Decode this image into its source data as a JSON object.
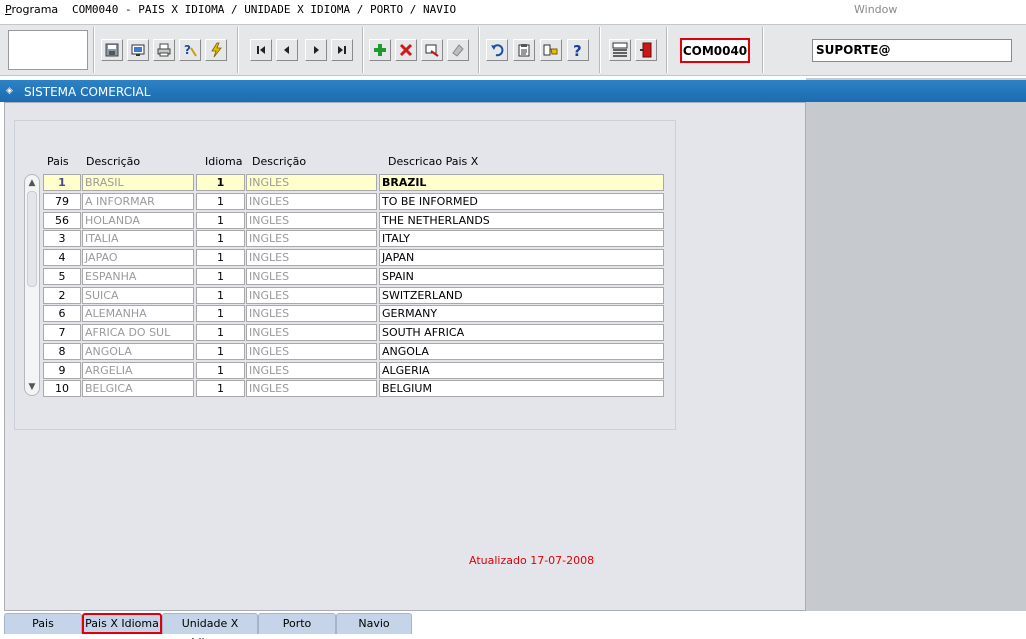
{
  "menubar": {
    "programa": "Programa",
    "title": "COM0040 - PAIS X IDIOMA / UNIDADE X IDIOMA / PORTO / NAVIO",
    "window": "Window"
  },
  "toolbar": {
    "module_code": "COM0040",
    "user": "SUPORTE@",
    "buttons": [
      "save",
      "print-screen",
      "print",
      "help-query",
      "tools",
      "first-record",
      "previous-record",
      "next-record",
      "last-record",
      "insert-record",
      "delete-record",
      "duplicate-record",
      "clear-record",
      "undo",
      "clipboard",
      "options",
      "help",
      "menu",
      "exit"
    ]
  },
  "window": {
    "title": "SISTEMA COMERCIAL"
  },
  "grid": {
    "headers": {
      "pais": "Pais",
      "descricao1": "Descrição",
      "idioma": "Idioma",
      "descricao2": "Descrição",
      "descricao_pais": "Descricao Pais X"
    },
    "rows": [
      {
        "pais": "1",
        "descricao": "BRASIL",
        "idioma": "1",
        "idioma_desc": "INGLES",
        "traducao": "BRAZIL"
      },
      {
        "pais": "79",
        "descricao": "A INFORMAR",
        "idioma": "1",
        "idioma_desc": "INGLES",
        "traducao": "TO BE INFORMED"
      },
      {
        "pais": "56",
        "descricao": "HOLANDA",
        "idioma": "1",
        "idioma_desc": "INGLES",
        "traducao": "THE NETHERLANDS"
      },
      {
        "pais": "3",
        "descricao": "ITALIA",
        "idioma": "1",
        "idioma_desc": "INGLES",
        "traducao": "ITALY"
      },
      {
        "pais": "4",
        "descricao": "JAPAO",
        "idioma": "1",
        "idioma_desc": "INGLES",
        "traducao": "JAPAN"
      },
      {
        "pais": "5",
        "descricao": "ESPANHA",
        "idioma": "1",
        "idioma_desc": "INGLES",
        "traducao": "SPAIN"
      },
      {
        "pais": "2",
        "descricao": "SUICA",
        "idioma": "1",
        "idioma_desc": "INGLES",
        "traducao": "SWITZERLAND"
      },
      {
        "pais": "6",
        "descricao": "ALEMANHA",
        "idioma": "1",
        "idioma_desc": "INGLES",
        "traducao": "GERMANY"
      },
      {
        "pais": "7",
        "descricao": "AFRICA DO SUL",
        "idioma": "1",
        "idioma_desc": "INGLES",
        "traducao": "SOUTH AFRICA"
      },
      {
        "pais": "8",
        "descricao": "ANGOLA",
        "idioma": "1",
        "idioma_desc": "INGLES",
        "traducao": "ANGOLA"
      },
      {
        "pais": "9",
        "descricao": "ARGELIA",
        "idioma": "1",
        "idioma_desc": "INGLES",
        "traducao": "ALGERIA"
      },
      {
        "pais": "10",
        "descricao": "BELGICA",
        "idioma": "1",
        "idioma_desc": "INGLES",
        "traducao": "BELGIUM"
      }
    ]
  },
  "status": {
    "updated": "Atualizado 17-07-2008"
  },
  "tabs": [
    {
      "label": "Pais"
    },
    {
      "label": "Pais X Idioma",
      "active": true
    },
    {
      "label": "Unidade X Idioma"
    },
    {
      "label": "Porto"
    },
    {
      "label": "Navio"
    }
  ],
  "colors": {
    "title_bar": "#1b6cb0",
    "highlight": "#e0000a",
    "selected_row": "#ffffcc"
  }
}
